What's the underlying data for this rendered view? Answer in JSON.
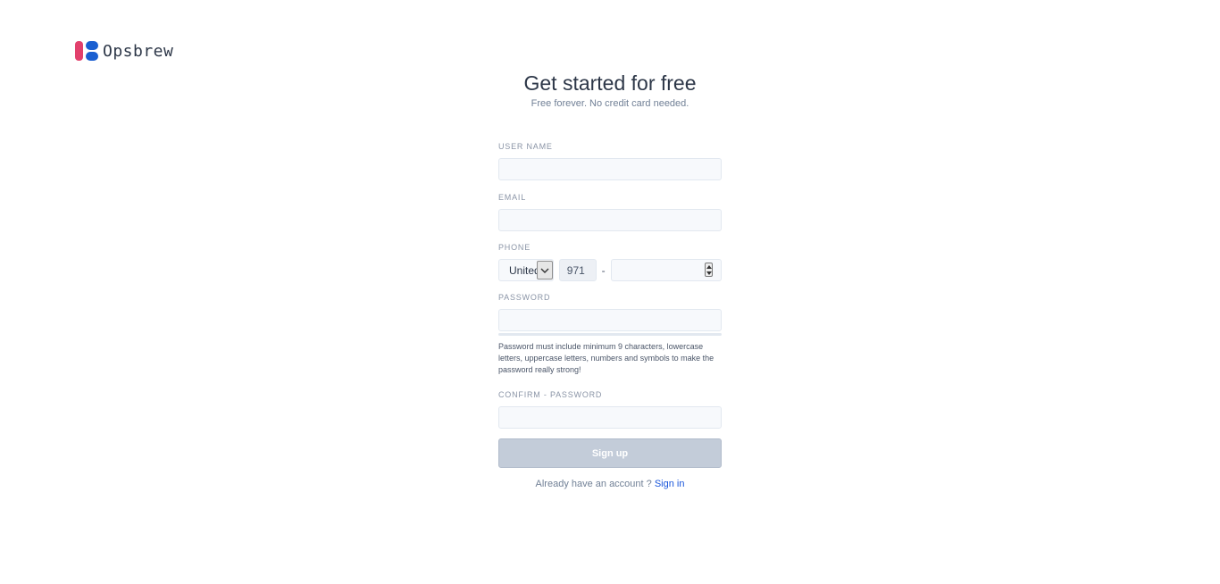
{
  "brand": {
    "name": "Opsbrew"
  },
  "header": {
    "title": "Get started for free",
    "subtitle": "Free forever. No credit card needed."
  },
  "form": {
    "username": {
      "label": "USER NAME",
      "value": ""
    },
    "email": {
      "label": "EMAIL",
      "value": ""
    },
    "phone": {
      "label": "PHONE",
      "country": "United",
      "code": "971",
      "separator": "-",
      "number": ""
    },
    "password": {
      "label": "PASSWORD",
      "value": "",
      "hint": "Password must include minimum 9 characters, lowercase letters, uppercase letters, numbers and symbols to make the password really strong!"
    },
    "confirm_password": {
      "label": "CONFIRM - PASSWORD",
      "value": ""
    },
    "submit_label": "Sign up"
  },
  "footer": {
    "prompt": "Already have an account ?",
    "link": "Sign in"
  },
  "colors": {
    "brand_red": "#e2406c",
    "brand_blue": "#1a5fd1",
    "button_disabled": "#c3ccd9",
    "link": "#1a56db"
  }
}
